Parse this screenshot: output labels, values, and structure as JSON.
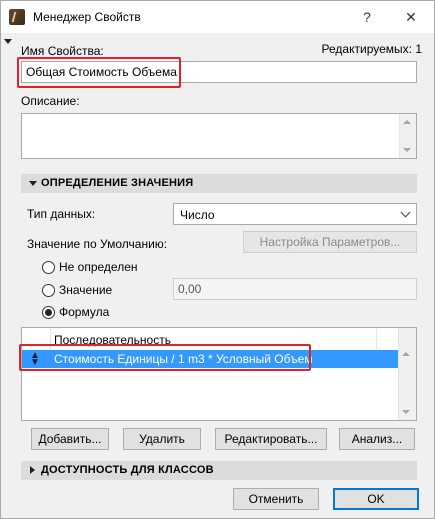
{
  "window": {
    "title": "Менеджер Свойств",
    "help_glyph": "?",
    "close_glyph": "✕"
  },
  "property": {
    "name_label": "Имя Свойства:",
    "editable_count": "Редактируемых: 1",
    "name_value": "Общая Стоимость Объема",
    "description_label": "Описание:",
    "description_value": ""
  },
  "value_definition": {
    "header": "ОПРЕДЕЛЕНИЕ ЗНАЧЕНИЯ",
    "data_type_label": "Тип данных:",
    "data_type_value": "Число",
    "default_value_label": "Значение по Умолчанию:",
    "parameter_settings_button": "Настройка Параметров...",
    "options": [
      {
        "label": "Не определен",
        "checked": false
      },
      {
        "label": "Значение",
        "checked": false
      },
      {
        "label": "Формула",
        "checked": true
      }
    ],
    "value_field": "0,00",
    "list": {
      "header": "Последовательность",
      "rows": [
        "Стоимость Единицы / 1 m3 * Условный Объем"
      ],
      "selected_index": 0
    },
    "buttons": {
      "add": "Добавить...",
      "remove": "Удалить",
      "edit": "Редактировать...",
      "analyze": "Анализ..."
    }
  },
  "class_availability": {
    "header": "ДОСТУПНОСТЬ ДЛЯ КЛАССОВ"
  },
  "footer": {
    "cancel": "Отменить",
    "ok": "OK"
  },
  "colors": {
    "highlight": "#e0222a",
    "selection": "#3399ff",
    "section_bar": "#dcdcdc"
  }
}
